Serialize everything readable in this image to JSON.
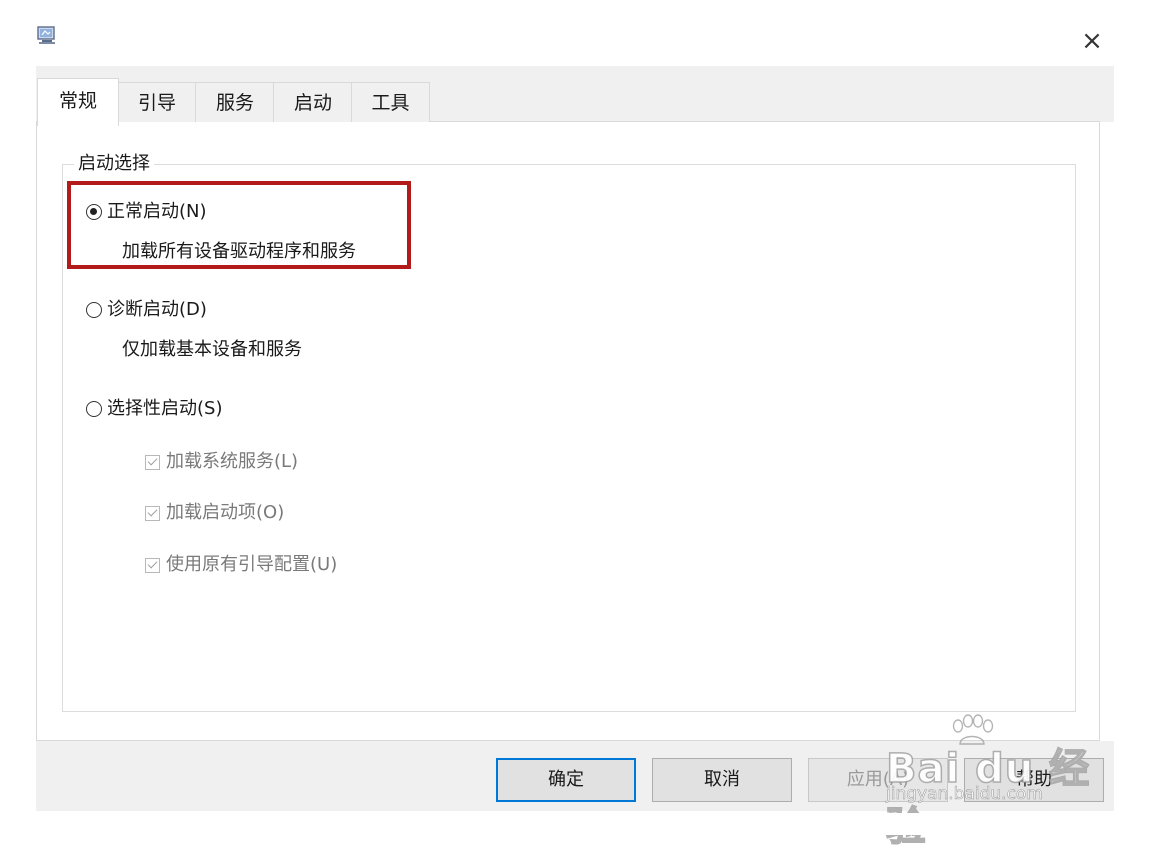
{
  "window": {
    "close_glyph": "×",
    "icon": "msconfig-app-icon"
  },
  "tabs": [
    {
      "label": "常规",
      "active": true
    },
    {
      "label": "引导",
      "active": false
    },
    {
      "label": "服务",
      "active": false
    },
    {
      "label": "启动",
      "active": false
    },
    {
      "label": "工具",
      "active": false
    }
  ],
  "startup_selection": {
    "legend": "启动选择",
    "normal": {
      "label": "正常启动(N)",
      "description": "加载所有设备驱动程序和服务",
      "selected": true
    },
    "diagnostic": {
      "label": "诊断启动(D)",
      "description": "仅加载基本设备和服务",
      "selected": false
    },
    "selective": {
      "label": "选择性启动(S)",
      "selected": false,
      "options": [
        {
          "label": "加载系统服务(L)",
          "checked": true,
          "enabled": false
        },
        {
          "label": "加载启动项(O)",
          "checked": true,
          "enabled": false
        },
        {
          "label": "使用原有引导配置(U)",
          "checked": true,
          "enabled": false
        }
      ]
    }
  },
  "buttons": {
    "ok": "确定",
    "cancel": "取消",
    "apply": "应用(A)",
    "help": "帮助"
  },
  "annotation": {
    "highlight_color": "#b31b1b"
  },
  "watermark": {
    "logo": "Bai du 经验",
    "url": "jingyan.baidu.com"
  },
  "colors": {
    "focus_border": "#0078d7",
    "chrome_bg": "#f0f0f0"
  }
}
